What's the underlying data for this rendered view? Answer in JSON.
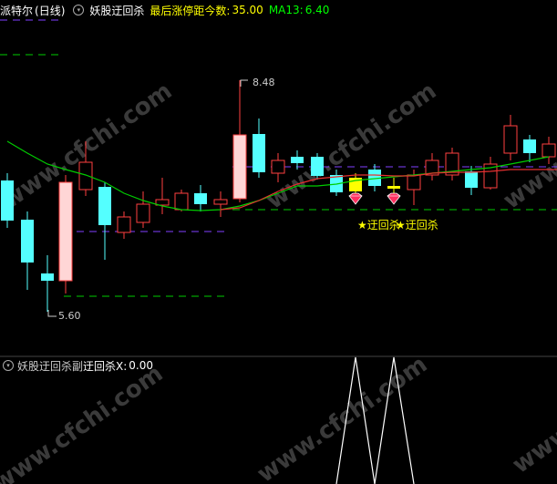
{
  "header": {
    "stock_name": "派特尔",
    "period": "(日线)",
    "indicator_name": "妖股迂回杀",
    "param_label": "最后涨停距今数:",
    "param_value": "35.00",
    "ma_label": "MA13:",
    "ma_value": "6.40"
  },
  "sub_header": {
    "indicator_name": "妖股迂回杀副",
    "param_label": "迂回杀X:",
    "param_value": "0.00"
  },
  "price_labels": {
    "high": "8.48",
    "low": "5.60"
  },
  "signal_label": "迂回杀",
  "watermark": "www.cfchi.com",
  "colors": {
    "up": "#ff4040",
    "down": "#54ffff",
    "ma": "#00cc00",
    "red_line": "#e63030",
    "dash_green": "#00cc00",
    "dash_purple": "#8040ff",
    "yellow": "#ffff00",
    "white": "#ffffff",
    "stock_name": "#ffffff",
    "indicator": "#00ffff",
    "param": "#ffff00",
    "ma_text": "#00ff00",
    "sub_name": "#cccccc"
  }
}
